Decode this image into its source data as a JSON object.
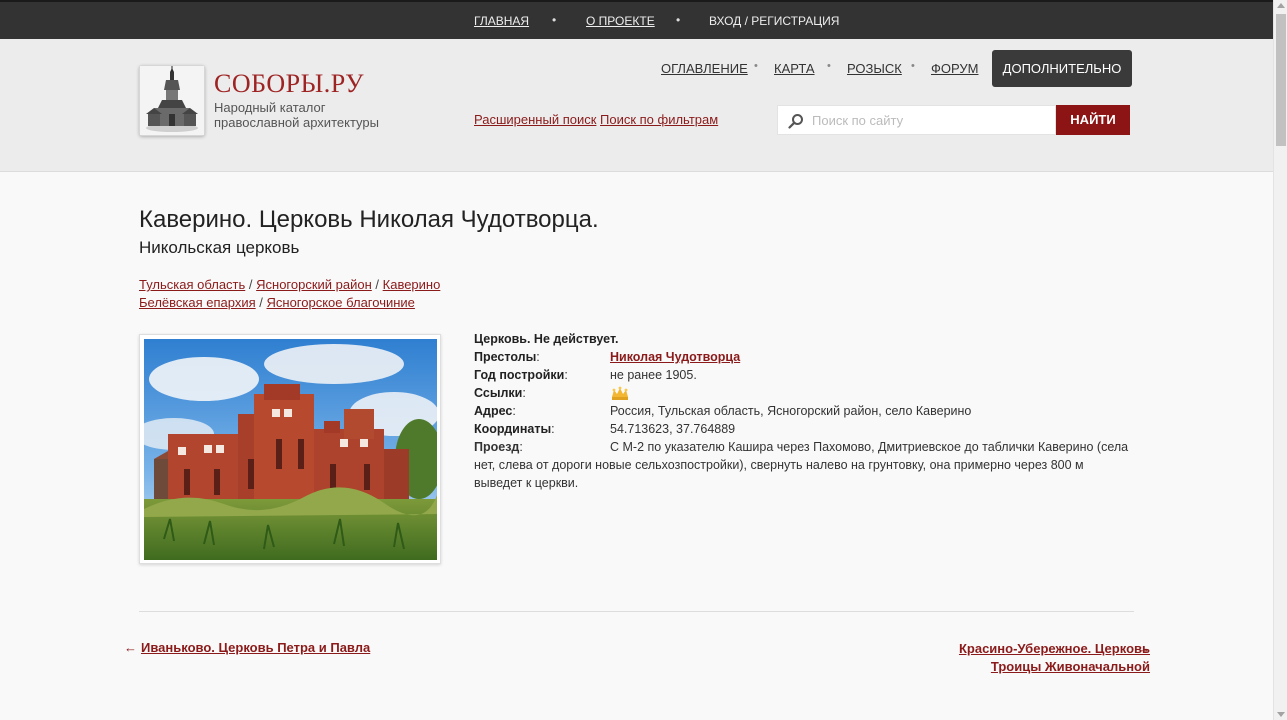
{
  "topbar": {
    "home": "ГЛАВНАЯ",
    "about": "О ПРОЕКТЕ",
    "login": "ВХОД / РЕГИСТРАЦИЯ",
    "dot": "•"
  },
  "logo": {
    "title": "СОБОРЫ.РУ",
    "subtitle": "Народный каталог православной архитектуры"
  },
  "nav": {
    "items": [
      "ОГЛАВЛЕНИЕ",
      "КАРТА",
      "РОЗЫСК",
      "ФОРУМ"
    ],
    "more": "ДОПОЛНИТЕЛЬНО"
  },
  "search": {
    "advanced": "Расширенный поиск",
    "filters": "Поиск по фильтрам",
    "placeholder": "Поиск по сайту",
    "button": "НАЙТИ"
  },
  "page": {
    "title": "Каверино. Церковь Николая Чудотворца.",
    "subtitle": "Никольская церковь",
    "crumbs1": [
      "Тульская область",
      "Ясногорский район",
      "Каверино"
    ],
    "crumbs2": [
      "Белёвская епархия",
      "Ясногорское благочиние"
    ],
    "sep": " / "
  },
  "info": {
    "status": "Церковь. Не действует.",
    "thrones_label": "Престолы",
    "thrones_value": "Николая Чудотворца",
    "year_label": "Год постройки",
    "year_value": "не ранее 1905.",
    "links_label": "Ссылки",
    "address_label": "Адрес",
    "address_value": "Россия, Тульская область, Ясногорский район, село Каверино",
    "coords_label": "Координаты",
    "coords_value": "54.713623, 37.764889",
    "route_label": "Проезд",
    "route_value": "С М-2 по указателю Кашира через Пахомово, Дмитриевское до таблички Каверино (села нет, слева от дороги новые сельхозпостройки), свернуть налево на грунтовку, она примерно через 800 м выведет к церкви.",
    "colon": ":"
  },
  "pager": {
    "prev_arrow": "←",
    "prev": "Иваньково. Церковь Петра и Павла",
    "next": "Красино-Убережное. Церковь Троицы Живоначальной",
    "next_arrow": "→"
  },
  "colors": {
    "accent": "#8c1414",
    "topbar": "#333333",
    "header": "#ececec"
  }
}
